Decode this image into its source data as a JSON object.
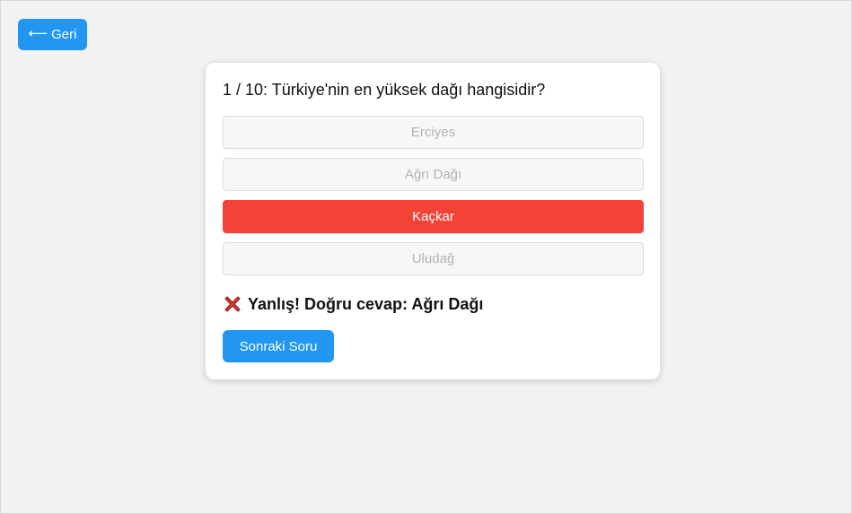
{
  "nav": {
    "back_label": "Geri",
    "back_icon": "arrow-left-icon"
  },
  "quiz": {
    "question": "1 / 10: Türkiye'nin en yüksek dağı hangisidir?",
    "options": [
      {
        "label": "Erciyes",
        "state": "disabled"
      },
      {
        "label": "Ağrı Dağı",
        "state": "disabled"
      },
      {
        "label": "Kaçkar",
        "state": "selected-wrong"
      },
      {
        "label": "Uludağ",
        "state": "disabled"
      }
    ],
    "feedback_icon": "cross-mark-icon",
    "feedback": "Yanlış! Doğru cevap: Ağrı Dağı",
    "next_label": "Sonraki Soru"
  },
  "colors": {
    "primary": "#2196f3",
    "wrong": "#f44336",
    "background": "#f2f2f2",
    "card": "#ffffff"
  }
}
